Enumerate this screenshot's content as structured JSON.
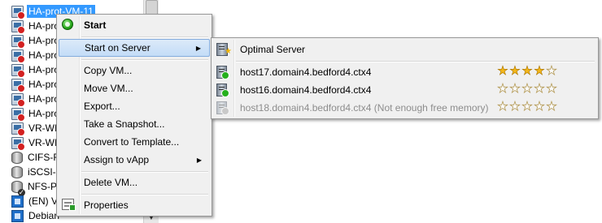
{
  "tree": {
    "items": [
      {
        "label": "HA-prot-VM-11",
        "icon": "vm-icon",
        "selected": true
      },
      {
        "label": "HA-pro",
        "icon": "vm-icon"
      },
      {
        "label": "HA-pro",
        "icon": "vm-icon"
      },
      {
        "label": "HA-pro",
        "icon": "vm-icon"
      },
      {
        "label": "HA-pro",
        "icon": "vm-icon"
      },
      {
        "label": "HA-pro",
        "icon": "vm-icon"
      },
      {
        "label": "HA-pro",
        "icon": "vm-icon"
      },
      {
        "label": "HA-pro",
        "icon": "vm-icon"
      },
      {
        "label": "VR-WI",
        "icon": "vm-icon"
      },
      {
        "label": "VR-WI",
        "icon": "vm-icon"
      },
      {
        "label": "CIFS-F",
        "icon": "storage-icon"
      },
      {
        "label": "iSCSI-",
        "icon": "storage-icon"
      },
      {
        "label": "NFS-P",
        "icon": "storage-icon"
      },
      {
        "label": "(EN) V",
        "icon": "template-icon"
      },
      {
        "label": "Debian",
        "icon": "template-icon"
      }
    ]
  },
  "context_menu": {
    "start": "Start",
    "start_on_server": "Start on Server",
    "copy_vm": "Copy VM...",
    "move_vm": "Move VM...",
    "export": "Export...",
    "take_snapshot": "Take a Snapshot...",
    "convert_to_template": "Convert to Template...",
    "assign_to_vapp": "Assign to vApp",
    "delete_vm": "Delete VM...",
    "properties": "Properties"
  },
  "submenu": {
    "optimal_server": "Optimal Server",
    "hosts": [
      {
        "label": "host17.domain4.bedford4.ctx4",
        "rating": 4,
        "max_rating": 5,
        "enabled": true
      },
      {
        "label": "host16.domain4.bedford4.ctx4",
        "rating": 0,
        "max_rating": 5,
        "enabled": true
      },
      {
        "label": "host18.domain4.bedford4.ctx4 (Not enough free memory)",
        "rating": 0,
        "max_rating": 5,
        "enabled": false
      }
    ]
  },
  "colors": {
    "selection": "#3399ff",
    "menu_background": "#f0f0f0",
    "menu_highlight": "#c3dcf7",
    "star_fill": "#f3b61a",
    "disabled_text": "#8d8d8d"
  }
}
